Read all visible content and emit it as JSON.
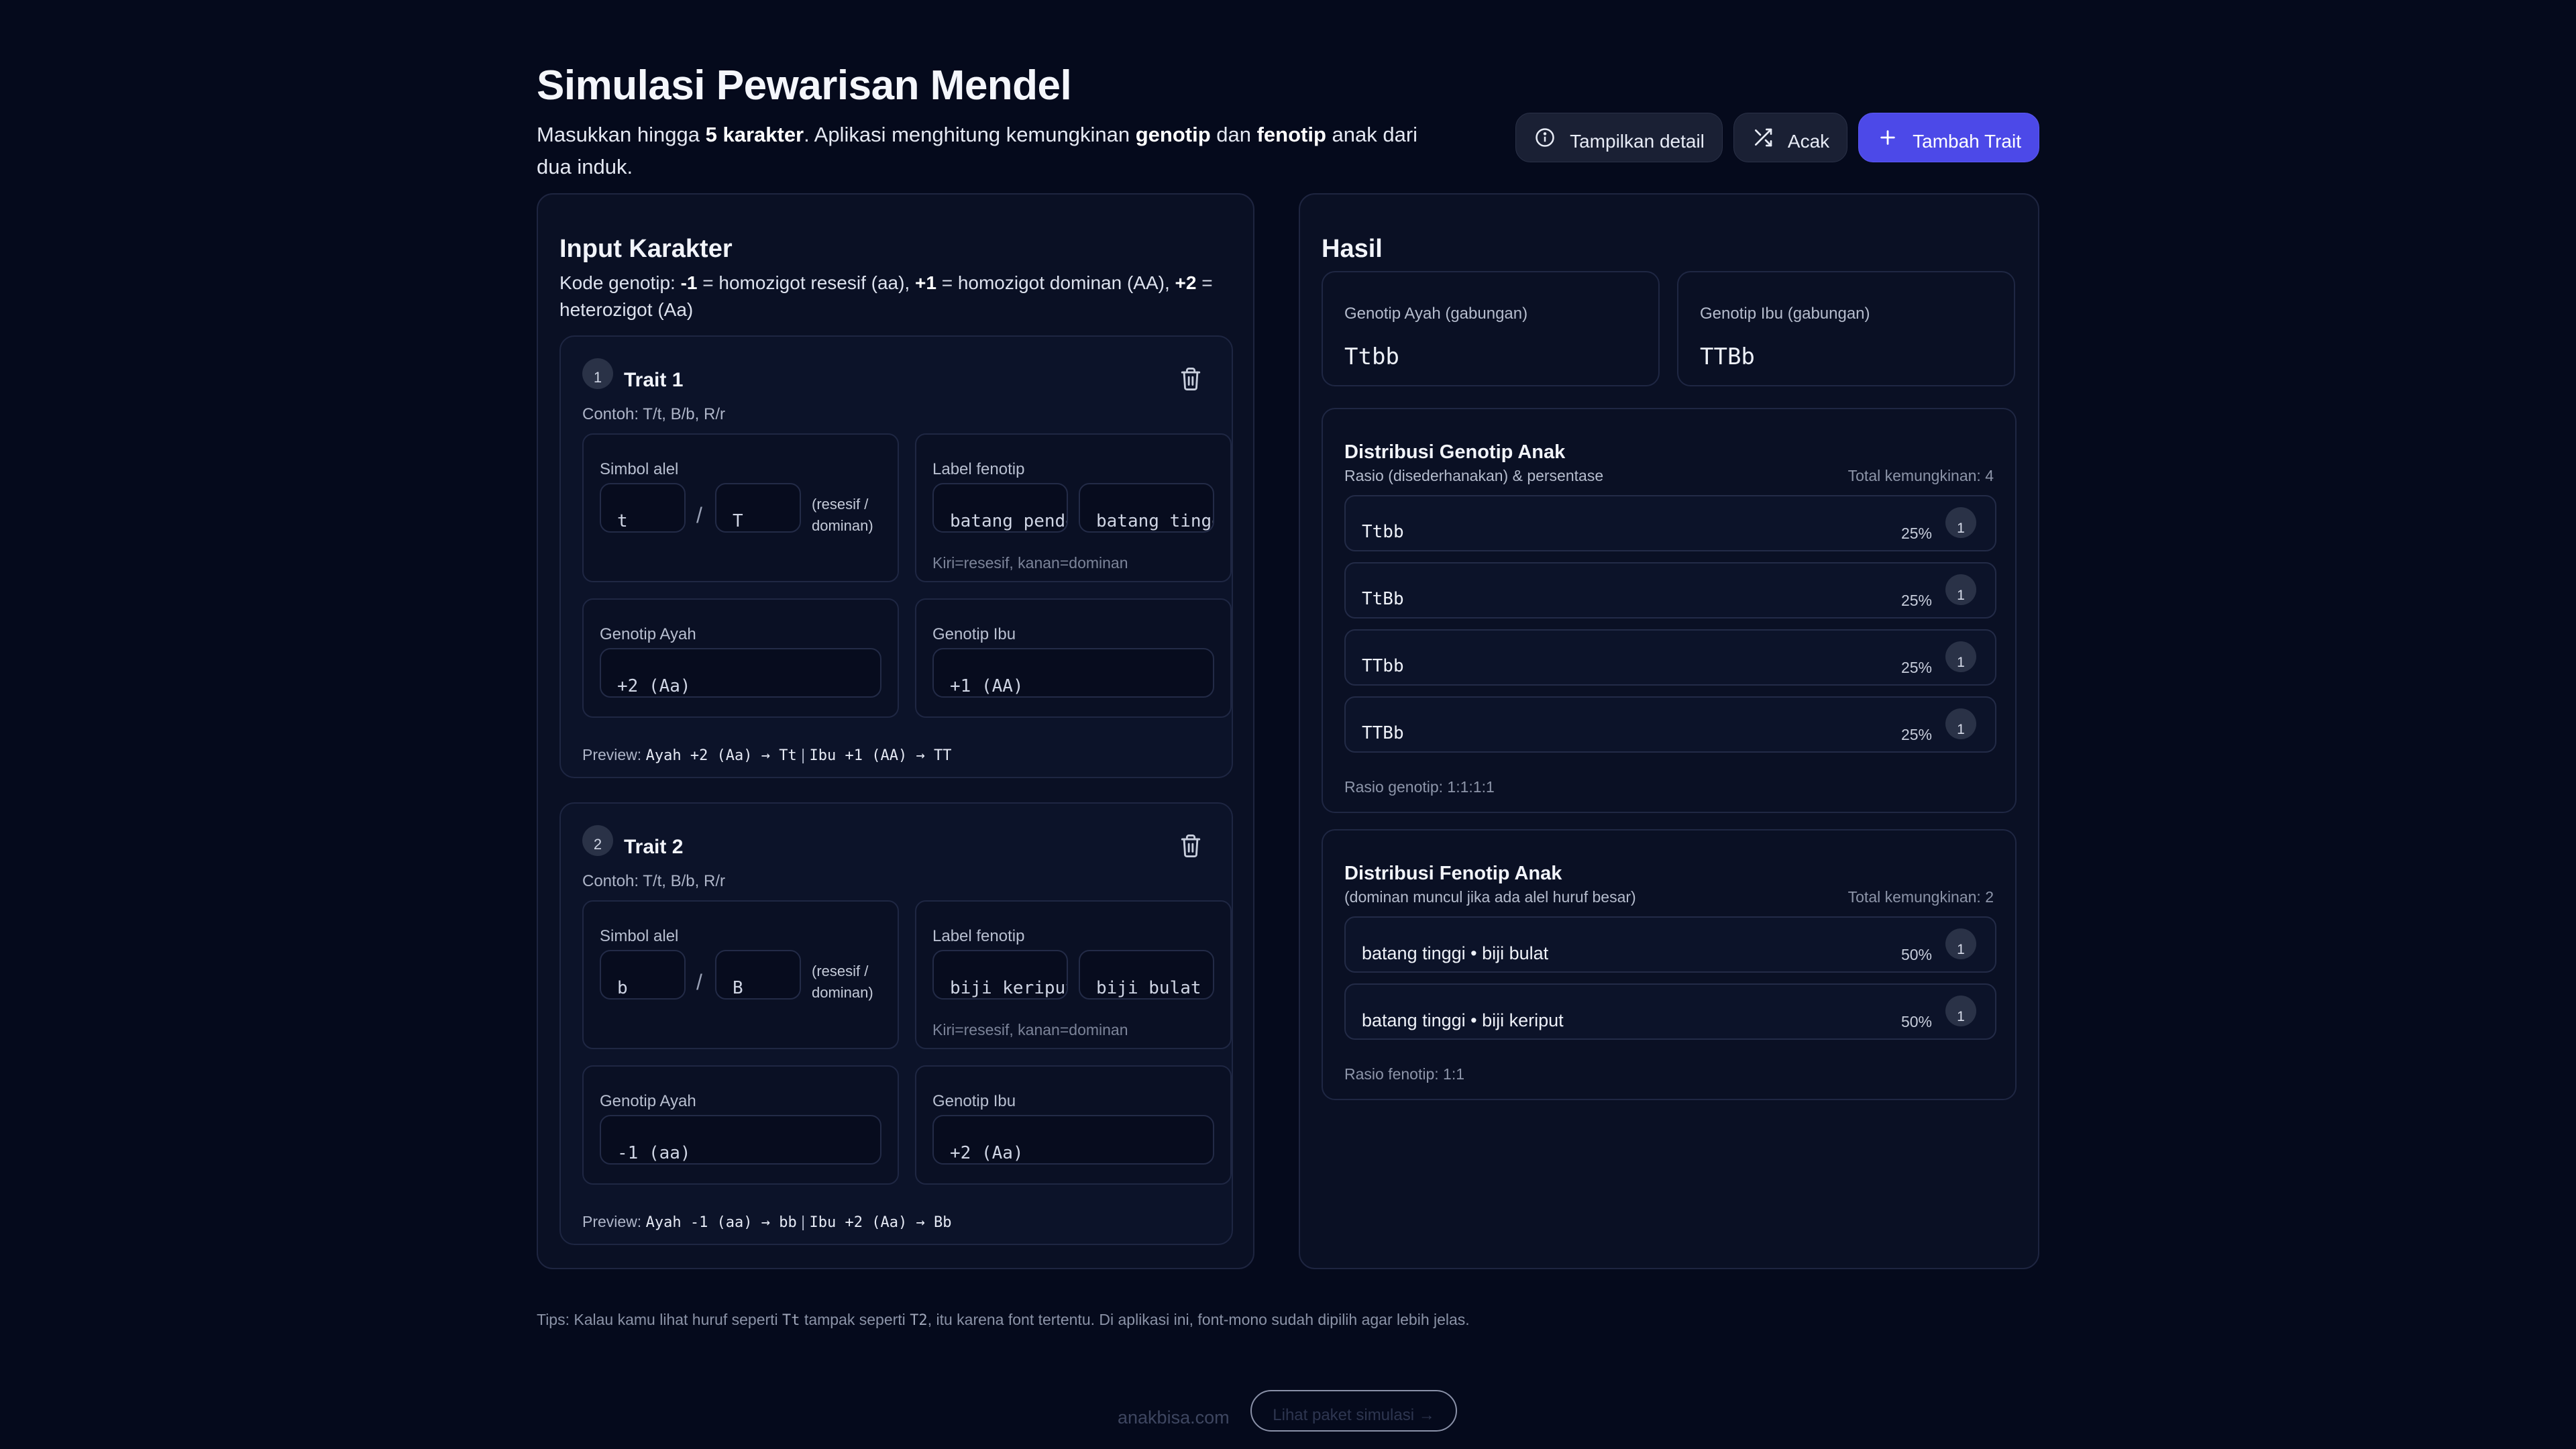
{
  "header": {
    "title": "Simulasi Pewarisan Mendel",
    "subtitle_parts": [
      "Masukkan hingga ",
      "5 karakter",
      ". Aplikasi menghitung kemungkinan ",
      "genotip",
      " dan ",
      "fenotip",
      " anak dari dua induk."
    ],
    "actions": {
      "detail_label": "Tampilkan detail",
      "random_label": "Acak",
      "add_label": "Tambah Trait"
    }
  },
  "input_panel": {
    "title": "Input Karakter",
    "desc_parts": [
      "Kode genotip: ",
      "-1",
      " = homozigot resesif (aa), ",
      "+1",
      " = homozigot dominan (AA), ",
      "+2",
      " = heterozigot (Aa)"
    ],
    "traits": [
      {
        "number": "1",
        "name": "Trait 1",
        "example": "Contoh: T/t, B/b, R/r",
        "allele_label": "Simbol alel",
        "allele_recessive": "t",
        "allele_dominant": "T",
        "allele_hint": "(resesif / dominan)",
        "phenotype_label": "Label fenotip",
        "phenotype_recessive": "batang pendek",
        "phenotype_dominant": "batang tinggi",
        "phenotype_hint": "Kiri=resesif, kanan=dominan",
        "father_label": "Genotip Ayah",
        "father_value": "+2 (Aa)",
        "mother_label": "Genotip Ibu",
        "mother_value": "+1 (AA)",
        "preview_label": "Preview:",
        "preview_father": "Ayah +2 (Aa) → Tt",
        "preview_sep": "|",
        "preview_mother": "Ibu +1 (AA) → TT"
      },
      {
        "number": "2",
        "name": "Trait 2",
        "example": "Contoh: T/t, B/b, R/r",
        "allele_label": "Simbol alel",
        "allele_recessive": "b",
        "allele_dominant": "B",
        "allele_hint": "(resesif / dominan)",
        "phenotype_label": "Label fenotip",
        "phenotype_recessive": "biji keriput",
        "phenotype_dominant": "biji bulat",
        "phenotype_hint": "Kiri=resesif, kanan=dominan",
        "father_label": "Genotip Ayah",
        "father_value": "-1 (aa)",
        "mother_label": "Genotip Ibu",
        "mother_value": "+2 (Aa)",
        "preview_label": "Preview:",
        "preview_father": "Ayah -1 (aa) → bb",
        "preview_sep": "|",
        "preview_mother": "Ibu +2 (Aa) → Bb"
      }
    ]
  },
  "result_panel": {
    "title": "Hasil",
    "father_combined_label": "Genotip Ayah (gabungan)",
    "father_combined_value": "Ttbb",
    "mother_combined_label": "Genotip Ibu (gabungan)",
    "mother_combined_value": "TTBb",
    "genotype_dist": {
      "title": "Distribusi Genotip Anak",
      "subtitle": "Rasio (disederhanakan) & persentase",
      "total": "Total kemungkinan: 4",
      "rows": [
        {
          "label": "Ttbb",
          "percent": "25%",
          "count": "1"
        },
        {
          "label": "TtBb",
          "percent": "25%",
          "count": "1"
        },
        {
          "label": "TTbb",
          "percent": "25%",
          "count": "1"
        },
        {
          "label": "TTBb",
          "percent": "25%",
          "count": "1"
        }
      ],
      "footer": "Rasio genotip: 1:1:1:1"
    },
    "phenotype_dist": {
      "title": "Distribusi Fenotip Anak",
      "subtitle": "(dominan muncul jika ada alel huruf besar)",
      "total": "Total kemungkinan: 2",
      "rows": [
        {
          "label": "batang tinggi • biji bulat",
          "percent": "50%",
          "count": "1"
        },
        {
          "label": "batang tinggi • biji keriput",
          "percent": "50%",
          "count": "1"
        }
      ],
      "footer": "Rasio fenotip: 1:1"
    }
  },
  "footer": {
    "tips_before": "Tips: Kalau kamu lihat huruf seperti ",
    "tips_sample1": "Tt",
    "tips_middle": " tampak seperti ",
    "tips_sample2": "T2",
    "tips_after": ", itu karena font tertentu. Di aplikasi ini, font-mono sudah dipilih agar lebih jelas.",
    "brand": "anakbisa.com",
    "link_label": "Lihat paket simulasi →"
  }
}
